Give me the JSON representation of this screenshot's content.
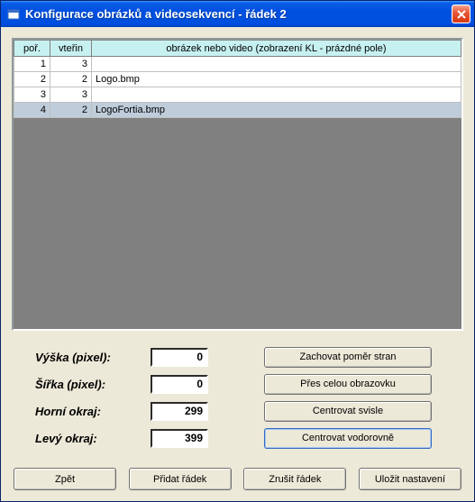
{
  "title": "Konfigurace obrázků a videosekvencí - řádek 2",
  "grid": {
    "headers": {
      "col1": "poř.",
      "col2": "vteřin",
      "col3": "obrázek nebo video (zobrazení KL - prázdné pole)"
    },
    "rows": [
      {
        "por": "1",
        "sec": "3",
        "file": ""
      },
      {
        "por": "2",
        "sec": "2",
        "file": "Logo.bmp"
      },
      {
        "por": "3",
        "sec": "3",
        "file": ""
      },
      {
        "por": "4",
        "sec": "2",
        "file": "LogoFortia.bmp"
      }
    ],
    "selectedRow": 3
  },
  "form": {
    "heightLabel": "Výška (pixel):",
    "heightValue": "0",
    "widthLabel": "Šířka (pixel):",
    "widthValue": "0",
    "topLabel": "Horní okraj:",
    "topValue": "299",
    "leftLabel": "Levý okraj:",
    "leftValue": "399",
    "btnRatio": "Zachovat poměr stran",
    "btnFull": "Přes celou obrazovku",
    "btnCenterV": "Centrovat svisle",
    "btnCenterH": "Centrovat vodorovně"
  },
  "footer": {
    "back": "Zpět",
    "addRow": "Přidat řádek",
    "delRow": "Zrušit řádek",
    "save": "Uložit nastavení"
  }
}
